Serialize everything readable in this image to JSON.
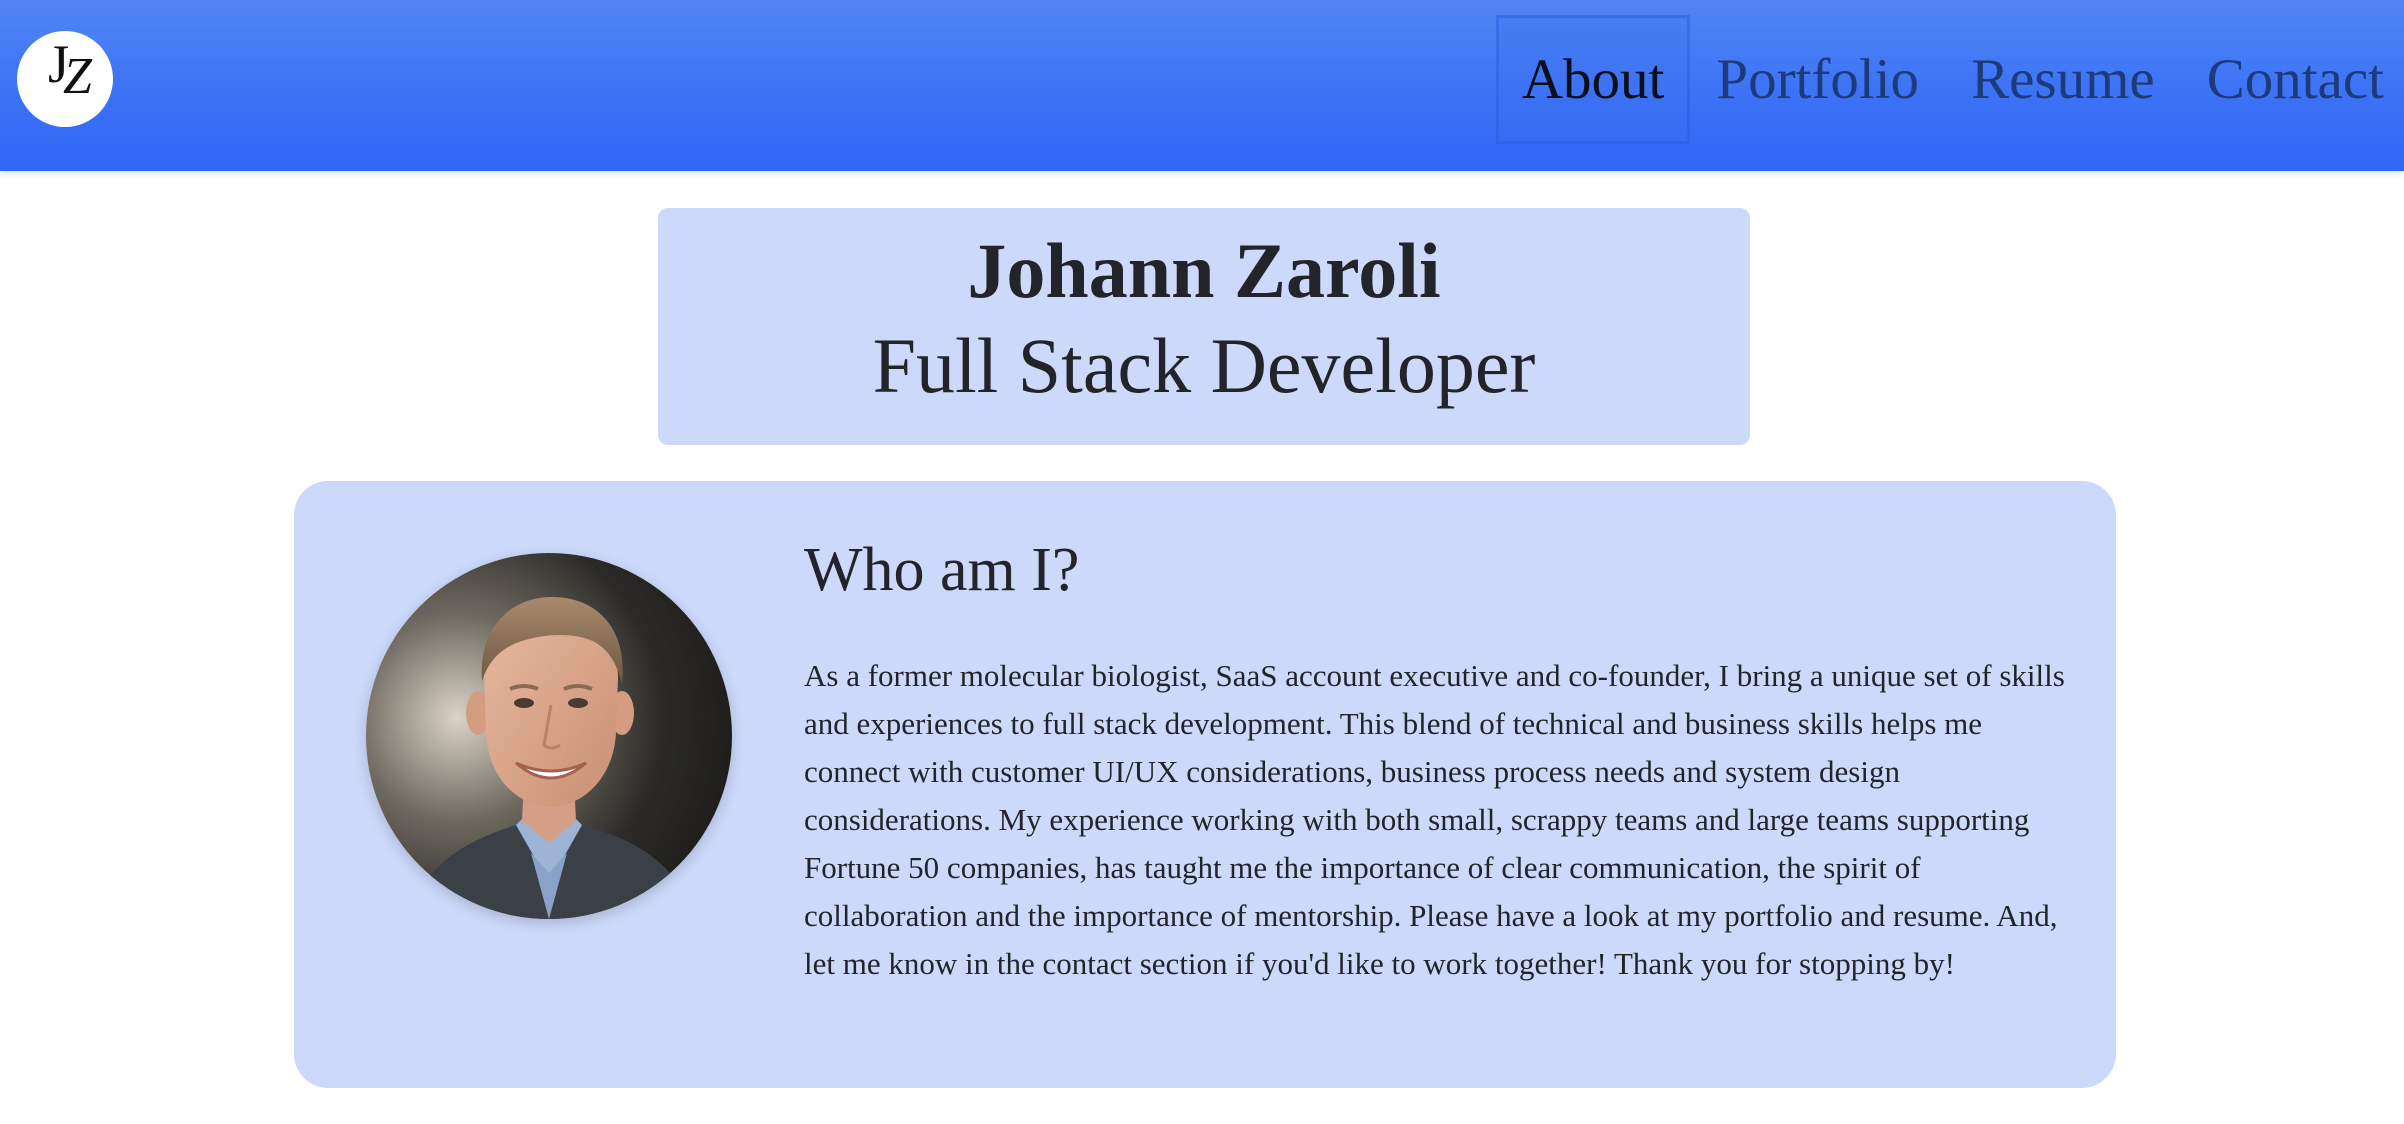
{
  "nav": {
    "logo_text": "JZ",
    "items": [
      {
        "label": "About",
        "active": true
      },
      {
        "label": "Portfolio",
        "active": false
      },
      {
        "label": "Resume",
        "active": false
      },
      {
        "label": "Contact",
        "active": false
      }
    ]
  },
  "header": {
    "name": "Johann Zaroli",
    "role": "Full Stack Developer"
  },
  "about": {
    "title": "Who am I?",
    "text": "As a former molecular biologist, SaaS account executive and co-founder, I bring a unique set of skills and experiences to full stack development. This blend of technical and business skills helps me connect with customer UI/UX considerations, business process needs and system design considerations. My experience working with both small, scrappy teams and large teams supporting Fortune 50 companies, has taught me the importance of clear communication, the spirit of collaboration and the importance of mentorship. Please have a look at my portfolio and resume. And, let me know in the contact section if you'd like to work together! Thank you for stopping by!",
    "photo_icon": "profile-photo"
  },
  "colors": {
    "navbar": "#3c72f5",
    "card_background": "#ccd9fa",
    "text": "#212529"
  }
}
